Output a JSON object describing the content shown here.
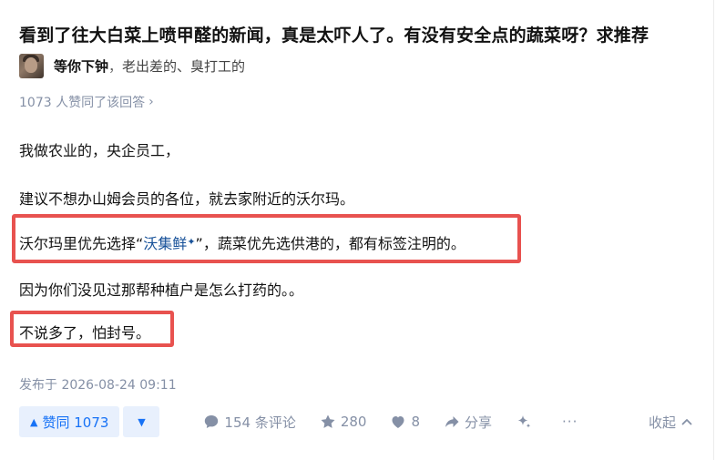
{
  "question": {
    "title": "看到了往大白菜上喷甲醛的新闻，真是太吓人了。有没有安全点的蔬菜呀？求推荐"
  },
  "author": {
    "name": "等你下钟",
    "separator": "，",
    "bio": "老出差的、臭打工的"
  },
  "votes_line": {
    "text": "1073 人赞同了该回答",
    "chevron": "›"
  },
  "content": {
    "p1": "我做农业的，央企员工，",
    "p2": "建议不想办山姆会员的各位，就去家附近的沃尔玛。",
    "p3_before": "沃尔玛里优先选择“",
    "p3_link": "沃集鲜",
    "p3_spark": "✦",
    "p3_after": "”，蔬菜优先选供港的，都有标签注明的。",
    "p4": "因为你们没见过那帮种植户是怎么打药的。。",
    "p5": "不说多了，怕封号。"
  },
  "published": "发布于 2026-08-24 09:11",
  "actions": {
    "vote_up_arrow": "▲",
    "vote_up_label": "赞同 1073",
    "vote_down_arrow": "▼",
    "comments": "154 条评论",
    "favorites": "280",
    "likes": "8",
    "share": "分享",
    "more": "···",
    "collapse": "收起"
  },
  "colors": {
    "highlight_border": "#e8524f",
    "vote_bg": "#e8f0fd",
    "vote_text": "#1772f6",
    "meta_gray": "#8590a6",
    "link_blue": "#175199"
  }
}
